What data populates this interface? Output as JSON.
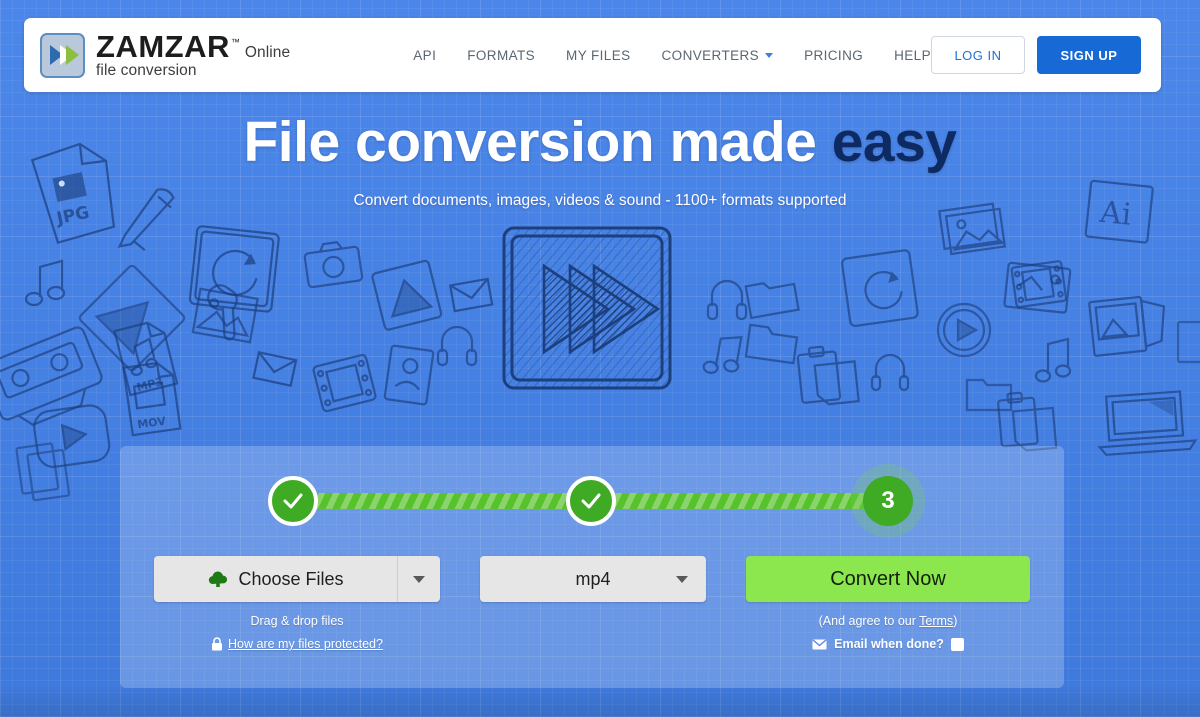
{
  "brand": {
    "name": "ZAMZAR",
    "tm": "™",
    "tagline": "Online file conversion",
    "logo_icon": "double-chevron-logo-icon",
    "accent_blue": "#1769d6",
    "accent_green": "#8ce74f",
    "background_blue": "#4280e9"
  },
  "nav": {
    "items": [
      {
        "label": "API",
        "has_caret": false
      },
      {
        "label": "FORMATS",
        "has_caret": false
      },
      {
        "label": "MY FILES",
        "has_caret": false
      },
      {
        "label": "CONVERTERS",
        "has_caret": true
      },
      {
        "label": "PRICING",
        "has_caret": false
      },
      {
        "label": "HELP",
        "has_caret": false
      }
    ],
    "login_label": "LOG IN",
    "signup_label": "SIGN UP"
  },
  "hero": {
    "headline_plain": "File conversion made ",
    "headline_bold": "easy",
    "subhead": "Convert documents, images, videos & sound - 1100+ formats supported",
    "art_icon": "fast-forward-video-doodle-icon"
  },
  "widget": {
    "steps": [
      {
        "state": "done",
        "label": "✓"
      },
      {
        "state": "done",
        "label": "✓"
      },
      {
        "state": "current",
        "label": "3"
      }
    ],
    "choose_files_label": "Choose Files",
    "choose_files_icon": "upload-cloud-icon",
    "drag_note": "Drag & drop files",
    "protect_link_label": "How are my files protected?",
    "protect_icon": "lock-icon",
    "format_value": "mp4",
    "convert_label": "Convert Now",
    "terms_prefix": "(And agree to our ",
    "terms_link": "Terms",
    "terms_suffix": ")",
    "email_label": "Email when done?",
    "email_icon": "envelope-icon",
    "email_checked": false
  }
}
